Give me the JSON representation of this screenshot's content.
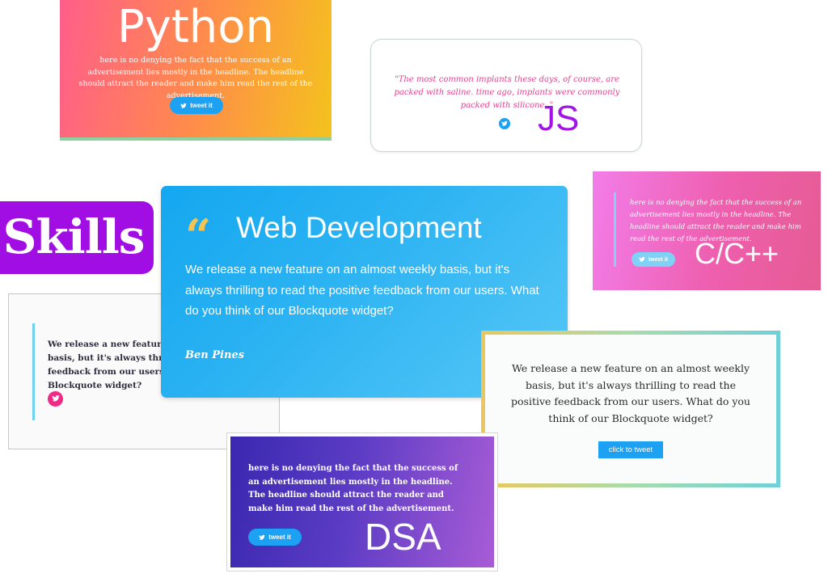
{
  "python_card": {
    "label": "Python",
    "body": "here is no denying the fact that the success of an advertisement lies mostly in the headline. The headline should attract the reader and make him read the rest of the advertisement.",
    "button": "tweet it"
  },
  "js_card": {
    "quote": "\"The most common implants these days, of course, are packed with saline. time ago, implants were commonly packed with silicone. \"",
    "label": "JS"
  },
  "cpp_card": {
    "body": "here is no denying the fact that the success of an advertisement lies mostly in the headline. The headline should attract the reader and make him read the rest of the advertisement.",
    "button": "tweet it",
    "label": "C/C++"
  },
  "skills_tag": {
    "label": "Skills"
  },
  "light_card": {
    "body": "We release a new feature on an almost weekly basis, but it's always thrilling to read the positive feedback from our users. What do you think of our Blockquote widget?"
  },
  "webdev_card": {
    "quote_mark": "“",
    "title": "Web Development",
    "body": "We release a new feature on an almost weekly basis, but it's always thrilling to read the positive feedback from our users. What do you think of our Blockquote widget?",
    "author": "Ben Pines"
  },
  "frame_card": {
    "body": "We release a new feature on an almost weekly basis, but it's always thrilling to read the positive feedback from our users. What do you think of our Blockquote widget?",
    "button": "click to tweet"
  },
  "dsa_card": {
    "body": "here is no denying the fact that the success of an advertisement lies mostly in the headline. The headline should attract the reader and make him read the rest of the advertisement.",
    "button": "tweet it",
    "label": "DSA"
  },
  "colors": {
    "twitter_blue": "#1da1f2",
    "skills_purple": "#a00ee3",
    "js_purple": "#a214e6",
    "pink_quote": "#e8418e"
  },
  "icons": [
    "twitter-bird-icon",
    "quote-mark-icon"
  ]
}
